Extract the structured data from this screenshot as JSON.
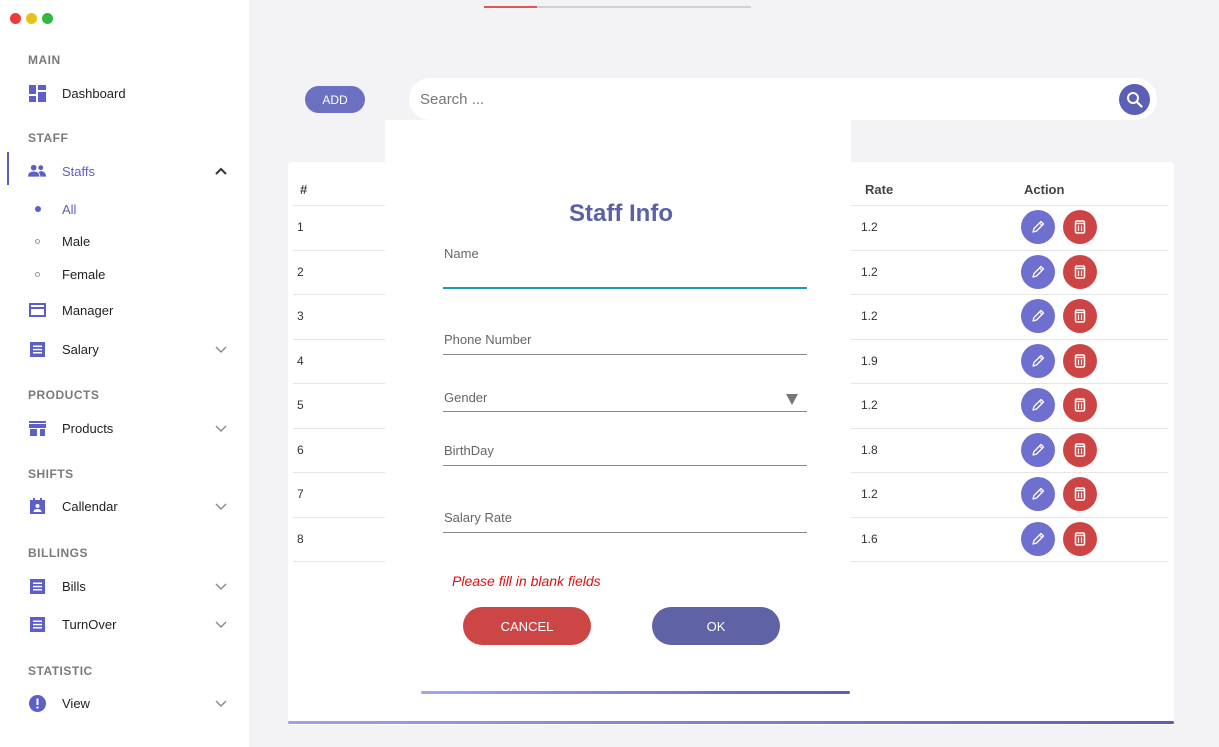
{
  "window": {
    "controls": {
      "close_color": "#ec3b3b",
      "minimize_color": "#e8c21c",
      "maximize_color": "#33b644"
    }
  },
  "sidebar": {
    "sections": {
      "main": "MAIN",
      "staff": "STAFF",
      "products": "PRODUCTS",
      "shifts": "SHIFTS",
      "billings": "BILLINGS",
      "statistic": "STATISTIC"
    },
    "items": {
      "dashboard": {
        "label": "Dashboard",
        "icon": "dashboard-icon"
      },
      "staffs": {
        "label": "Staffs",
        "icon": "people-icon",
        "expanded": true
      },
      "manager": {
        "label": "Manager",
        "icon": "card-icon"
      },
      "salary": {
        "label": "Salary",
        "icon": "list-icon"
      },
      "products": {
        "label": "Products",
        "icon": "store-icon"
      },
      "calendar": {
        "label": "Callendar",
        "icon": "calendar-icon"
      },
      "bills": {
        "label": "Bills",
        "icon": "list-icon"
      },
      "turnover": {
        "label": "TurnOver",
        "icon": "list-icon"
      },
      "view": {
        "label": "View",
        "icon": "info-icon"
      }
    },
    "staff_sub": {
      "all": "All",
      "male": "Male",
      "female": "Female"
    },
    "accent_color": "#5b5fc7"
  },
  "toolbar": {
    "add_label": "ADD",
    "search_placeholder": "Search ..."
  },
  "table": {
    "headers": {
      "index": "#",
      "rate": "Rate",
      "action": "Action"
    },
    "rows": [
      {
        "index": "1",
        "rate": "1.2"
      },
      {
        "index": "2",
        "rate": "1.2"
      },
      {
        "index": "3",
        "rate": "1.2"
      },
      {
        "index": "4",
        "rate": "1.9"
      },
      {
        "index": "5",
        "rate": "1.2"
      },
      {
        "index": "6",
        "rate": "1.8"
      },
      {
        "index": "7",
        "rate": "1.2"
      },
      {
        "index": "8",
        "rate": "1.6"
      }
    ]
  },
  "dialog": {
    "title": "Staff Info",
    "fields": {
      "name": {
        "label": "Name",
        "value": ""
      },
      "phone": {
        "label": "Phone Number",
        "value": ""
      },
      "gender": {
        "label": "Gender",
        "value": ""
      },
      "birthday": {
        "label": "BirthDay",
        "value": ""
      },
      "salary_rate": {
        "label": "Salary Rate",
        "value": ""
      }
    },
    "error": "Please fill in blank fields",
    "cancel_label": "CANCEL",
    "ok_label": "OK"
  },
  "colors": {
    "primary": "#5f62a5",
    "danger": "#cc4646",
    "error_text": "#dd1111",
    "focus_line": "#1f9bb8"
  }
}
